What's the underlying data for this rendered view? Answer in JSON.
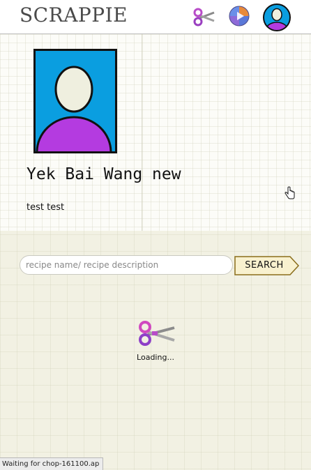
{
  "app": {
    "logo": "SCRAPPIE"
  },
  "nav": {
    "icons": [
      "scissors-icon",
      "compass-icon",
      "user-avatar-icon"
    ]
  },
  "profile": {
    "name": "Yek Bai Wang new",
    "bio": "test test",
    "photo_icon": "default-avatar-icon"
  },
  "search": {
    "placeholder": "recipe name/ recipe description",
    "value": "",
    "button_label": "SEARCH"
  },
  "loading": {
    "icon": "scissors-icon",
    "text": "Loading..."
  },
  "status_bar": {
    "text": "Waiting for chop-161100.ap"
  },
  "colors": {
    "avatar_bg": "#0a9ee0",
    "avatar_body": "#b43be0",
    "avatar_face": "#efefdf",
    "scissors_handle": "#b84cc8",
    "button_bg": "#f8f1cf",
    "button_border": "#8a6d1a"
  }
}
